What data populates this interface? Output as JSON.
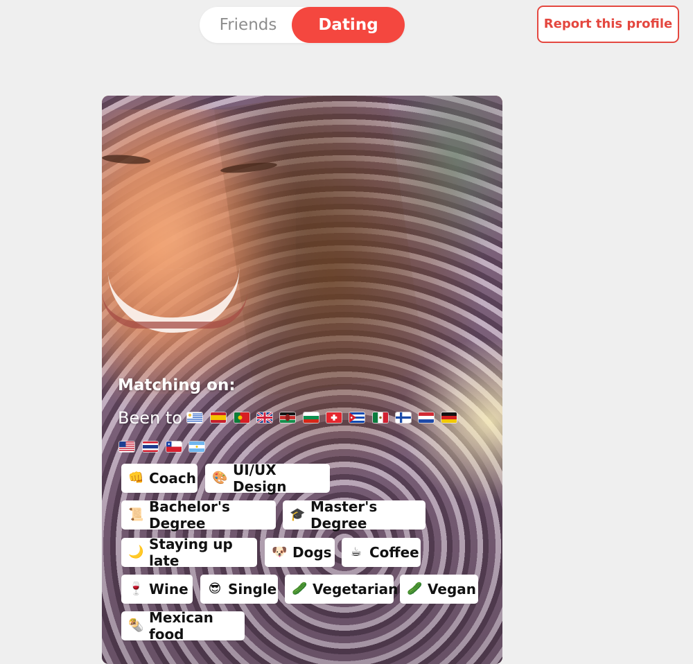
{
  "mode_toggle": {
    "friends": "Friends",
    "dating": "Dating",
    "selected": "Dating"
  },
  "report_button": {
    "label": "Report this profile"
  },
  "profile": {
    "matching_on_label": "Matching on:",
    "been_to_label": "Been to",
    "been_to_flags": [
      "uruguay-flag-icon",
      "spain-flag-icon",
      "portugal-flag-icon",
      "united-kingdom-flag-icon",
      "kenya-flag-icon",
      "bulgaria-flag-icon",
      "switzerland-flag-icon",
      "cuba-flag-icon",
      "mexico-flag-icon",
      "finland-flag-icon",
      "netherlands-flag-icon",
      "germany-flag-icon",
      "united-states-flag-icon",
      "thailand-flag-icon",
      "chile-flag-icon",
      "argentina-flag-icon"
    ],
    "tags": [
      {
        "label": "Coach",
        "icon": "fist-icon"
      },
      {
        "label": "UI/UX Design",
        "icon": "palette-icon"
      },
      {
        "label": "Bachelor's Degree",
        "icon": "scroll-icon"
      },
      {
        "label": "Master's Degree",
        "icon": "graduation-cap-icon"
      },
      {
        "label": "Staying up late",
        "icon": "moon-icon"
      },
      {
        "label": "Dogs",
        "icon": "dog-icon"
      },
      {
        "label": "Coffee",
        "icon": "coffee-icon"
      },
      {
        "label": "Wine",
        "icon": "wine-glass-icon"
      },
      {
        "label": "Single",
        "icon": "smiling-face-sunglasses-icon"
      },
      {
        "label": "Vegetarian",
        "icon": "cucumber-icon"
      },
      {
        "label": "Vegan",
        "icon": "cucumber-icon"
      },
      {
        "label": "Mexican food",
        "icon": "burrito-icon"
      }
    ]
  },
  "colors": {
    "accent": "#f4473f",
    "page_background": "#efefef",
    "chip_background": "#ffffff",
    "chip_text": "#111111"
  }
}
